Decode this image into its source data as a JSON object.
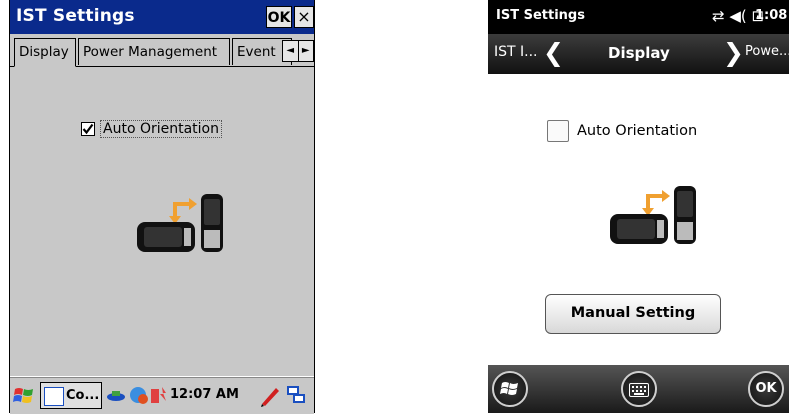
{
  "left": {
    "title": "IST Settings",
    "ok_label": "OK",
    "close_label": "×",
    "tabs": [
      {
        "label": "Display"
      },
      {
        "label": "Power Management"
      },
      {
        "label": "Event"
      }
    ],
    "tab_scroll_left": "◄",
    "tab_scroll_right": "►",
    "auto_orientation": {
      "label": "Auto Orientation",
      "checked": true
    },
    "taskbar": {
      "task_label": "Co...",
      "time": "12:07 AM"
    }
  },
  "right": {
    "status_title": "IST Settings",
    "status_icons": "⇄ ◀( ⊡",
    "status_time": "1:08",
    "nav": {
      "prev_label": "IST I...",
      "prev_chevron": "❮",
      "title": "Display",
      "next_chevron": "❯",
      "next_label": "Powe..."
    },
    "auto_orientation": {
      "label": "Auto Orientation",
      "checked": false
    },
    "manual_setting_label": "Manual Setting",
    "bottom": {
      "ok_label": "OK"
    }
  },
  "colors": {
    "ce_title_bar": "#0a2a8c",
    "ce_background": "#c8c8c8",
    "orientation_arrow": "#f0a030"
  }
}
